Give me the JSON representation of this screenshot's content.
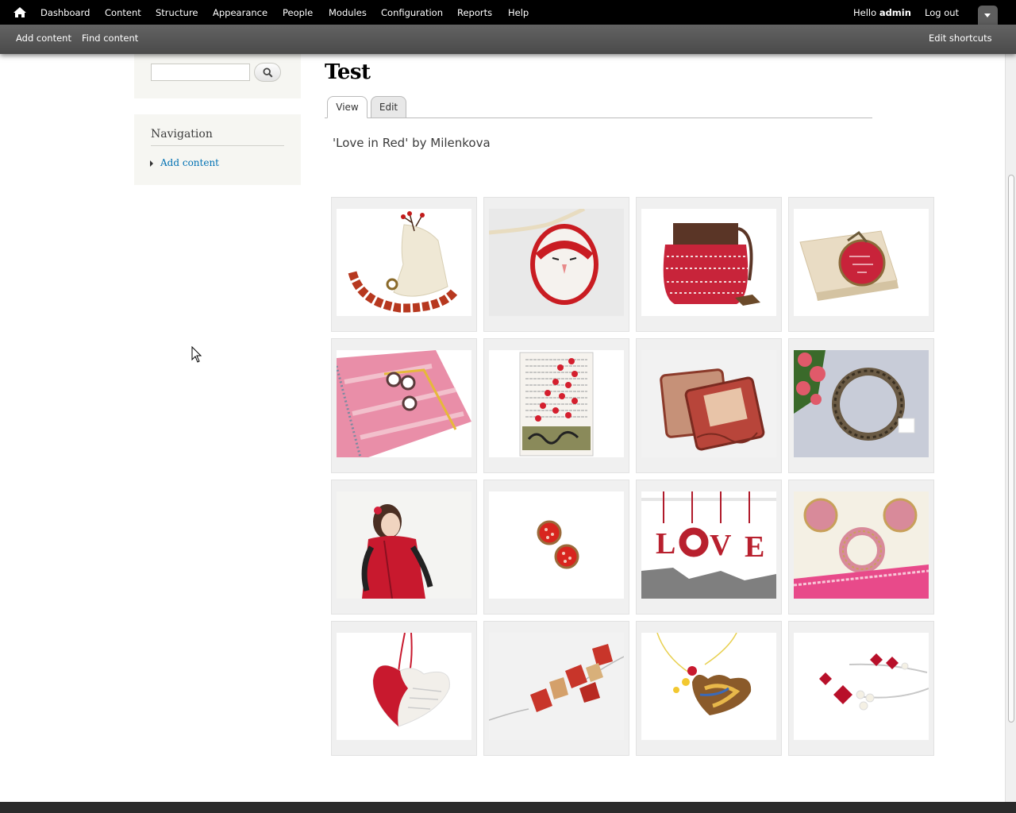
{
  "toolbar": {
    "menu": [
      "Dashboard",
      "Content",
      "Structure",
      "Appearance",
      "People",
      "Modules",
      "Configuration",
      "Reports",
      "Help"
    ],
    "hello_prefix": "Hello ",
    "username": "admin",
    "logout": "Log out",
    "shortcuts": [
      "Add content",
      "Find content"
    ],
    "edit_shortcuts": "Edit shortcuts"
  },
  "sidebar": {
    "search": {
      "value": ""
    },
    "navigation": {
      "title": "Navigation",
      "items": [
        "Add content"
      ]
    }
  },
  "main": {
    "title": "Test",
    "tabs": [
      "View",
      "Edit"
    ],
    "active_tab": "View",
    "body": "'Love in Red' by Milenkova"
  },
  "gallery": {
    "items": [
      "red-beaded-necklace-with-vase",
      "owl-pendant-necklace",
      "red-knitted-pouch",
      "red-circuit-brooch-on-box",
      "pink-mixed-media-notebook",
      "hearts-book-page-art-print",
      "red-decoupage-coasters",
      "round-mirror-with-roses",
      "woman-in-red-coat",
      "red-floral-stud-earrings",
      "love-letters-ornament",
      "pink-rhinestone-jewelry-set",
      "red-heart-ceramic-pendant",
      "red-stone-necklace",
      "heart-glass-pendant",
      "red-crystal-earrings"
    ]
  },
  "colors": {
    "link": "#0071b3",
    "toolbar": "#000000",
    "shortcuts_bar": "#5a5a5a",
    "sidebar_bg": "#f6f6f2"
  }
}
